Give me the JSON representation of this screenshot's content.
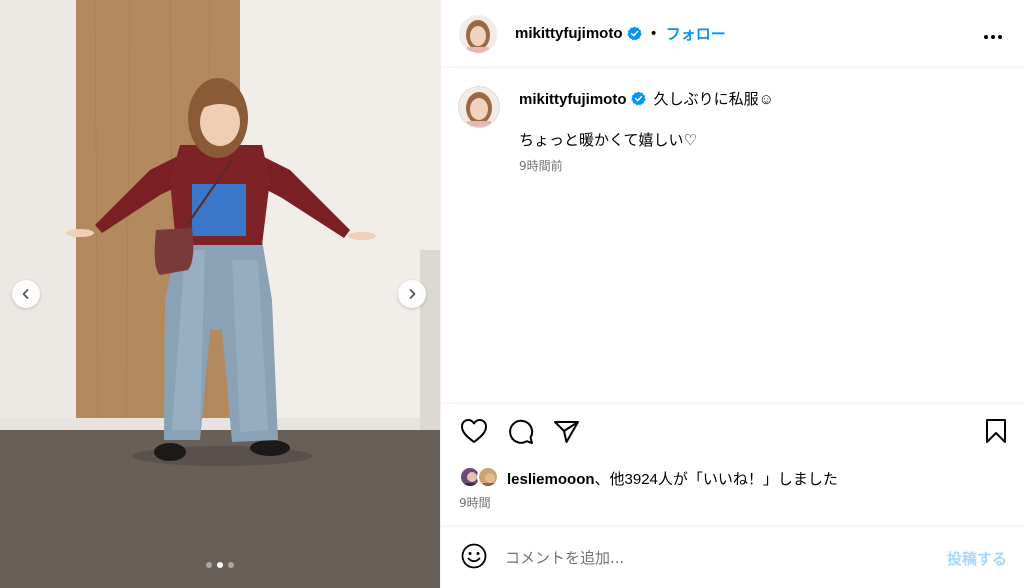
{
  "post": {
    "username": "mikittyfujimoto",
    "bullet": "•",
    "follow_label": "フォロー",
    "more_icon": "more-horizontal-icon",
    "caption": {
      "username": "mikittyfujimoto",
      "line1": "久しぶりに私服☺",
      "line2": "ちょっと暖かくて嬉しい♡",
      "time": "9時間前"
    },
    "carousel": {
      "slide_count": 3,
      "active_slide": 2,
      "prev_icon": "chevron-left-icon",
      "next_icon": "chevron-right-icon"
    },
    "actions": {
      "like_icon": "heart-icon",
      "comment_icon": "comment-icon",
      "share_icon": "paper-plane-icon",
      "save_icon": "bookmark-icon"
    },
    "likes": {
      "user": "lesliemooon",
      "rest": "、他3924人が「いいね！」しました"
    },
    "time": "9時間",
    "comment": {
      "emoji_icon": "smiley-icon",
      "placeholder": "コメントを追加...",
      "post_label": "投稿する"
    }
  },
  "colors": {
    "accent": "#0095f6",
    "verified": "#0095f6",
    "muted": "#737373",
    "post_disabled": "#a8d7fb"
  }
}
